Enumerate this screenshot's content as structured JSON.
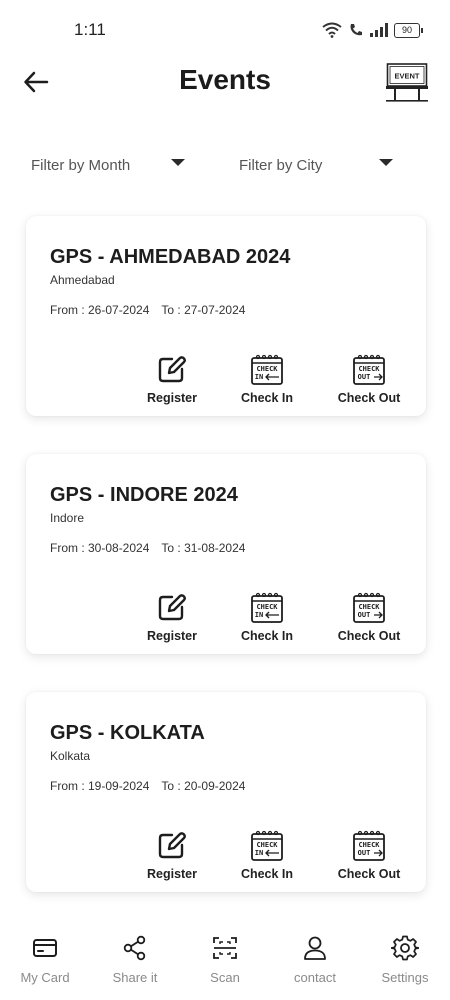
{
  "status": {
    "time": "1:11",
    "battery": "90"
  },
  "header": {
    "title": "Events",
    "event_sign": "EVENT"
  },
  "filters": {
    "month_label": "Filter by Month",
    "city_label": "Filter by City"
  },
  "events": [
    {
      "name": "GPS - AHMEDABAD 2024",
      "city": "Ahmedabad",
      "from": "From : 26-07-2024",
      "to": "To : 27-07-2024"
    },
    {
      "name": "GPS - INDORE 2024",
      "city": "Indore",
      "from": "From : 30-08-2024",
      "to": "To : 31-08-2024"
    },
    {
      "name": "GPS - KOLKATA",
      "city": "Kolkata",
      "from": "From : 19-09-2024",
      "to": "To : 20-09-2024"
    }
  ],
  "actions": {
    "register": "Register",
    "check_in": "Check In",
    "check_out": "Check Out",
    "check_in_icon_text": [
      "CHECK",
      "IN"
    ],
    "check_out_icon_text": [
      "CHECK",
      "OUT"
    ]
  },
  "nav": {
    "my_card": "My Card",
    "share_it": "Share it",
    "scan": "Scan",
    "contact": "contact",
    "settings": "Settings"
  },
  "icons": [
    "wifi-icon",
    "call-icon",
    "signal-icon",
    "battery-icon",
    "back-arrow-icon",
    "event-board-icon",
    "edit-icon",
    "calendar-check-in-icon",
    "calendar-check-out-icon",
    "card-icon",
    "share-icon",
    "scan-icon",
    "person-icon",
    "gear-icon"
  ]
}
